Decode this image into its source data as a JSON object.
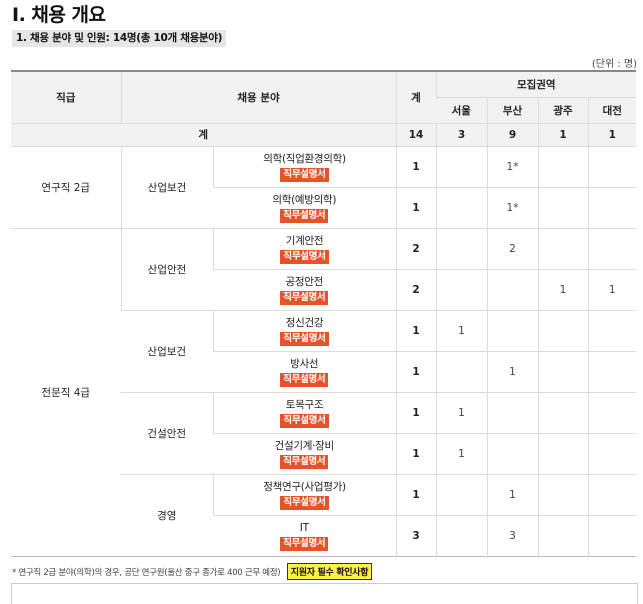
{
  "title": "I. 채용 개요",
  "subtitle": "1. 채용 분야 및 인원: 14명(총 10개 채용분야)",
  "unit": "(단위 : 명)",
  "headers": {
    "grade": "직급",
    "field": "채용 분야",
    "total": "계",
    "region": "모집권역",
    "regions": [
      "서울",
      "부산",
      "광주",
      "대전"
    ]
  },
  "sum_row": {
    "label": "계",
    "total": "14",
    "values": [
      "3",
      "9",
      "1",
      "1"
    ]
  },
  "jd_label": "직무설명서",
  "rows": [
    {
      "field": "의학(직업환경의학)",
      "total": "1",
      "values": [
        "",
        "1*",
        "",
        ""
      ]
    },
    {
      "field": "의학(예방의학)",
      "total": "1",
      "values": [
        "",
        "1*",
        "",
        ""
      ]
    },
    {
      "field": "기계안전",
      "total": "2",
      "values": [
        "",
        "2",
        "",
        ""
      ]
    },
    {
      "field": "공정안전",
      "total": "2",
      "values": [
        "",
        "",
        "1",
        "1"
      ]
    },
    {
      "field": "정신건강",
      "total": "1",
      "values": [
        "1",
        "",
        "",
        ""
      ]
    },
    {
      "field": "방사선",
      "total": "1",
      "values": [
        "",
        "1",
        "",
        ""
      ]
    },
    {
      "field": "토목구조",
      "total": "1",
      "values": [
        "1",
        "",
        "",
        ""
      ]
    },
    {
      "field": "건설기계·장비",
      "total": "1",
      "values": [
        "1",
        "",
        "",
        ""
      ]
    },
    {
      "field": "정책연구(사업평가)",
      "total": "1",
      "values": [
        "",
        "1",
        "",
        ""
      ]
    },
    {
      "field": "IT",
      "total": "3",
      "values": [
        "",
        "3",
        "",
        ""
      ]
    }
  ],
  "grades": [
    "연구직 2급",
    "전문직 4급"
  ],
  "categories": [
    "산업보건",
    "산업안전",
    "산업보건",
    "건설안전",
    "경영"
  ],
  "footnote": "* 연구직 2급 분야(의학)의 경우, 공단 연구원(울산 중구 종가로 400 근무 예정)",
  "footnote_tag": "지원자 필수 확인사항"
}
